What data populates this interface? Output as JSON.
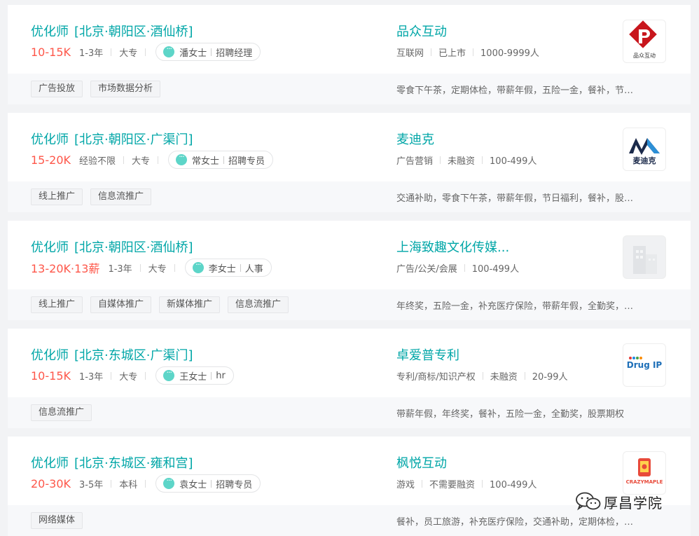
{
  "jobs": [
    {
      "title": "优化师",
      "location": "[北京·朝阳区·酒仙桥]",
      "salary": "10-15K",
      "experience": "1-3年",
      "degree": "大专",
      "recruiter_name": "潘女士",
      "recruiter_role": "招聘经理",
      "company": "品众互动",
      "industry": "互联网",
      "stage": "已上市",
      "size": "1000-9999人",
      "logo_text": "品众互动",
      "tags": [
        "广告投放",
        "市场数据分析"
      ],
      "welfare": "零食下午茶，定期体检，带薪年假，五险一金，餐补，节…"
    },
    {
      "title": "优化师",
      "location": "[北京·朝阳区·广渠门]",
      "salary": "15-20K",
      "experience": "经验不限",
      "degree": "大专",
      "recruiter_name": "常女士",
      "recruiter_role": "招聘专员",
      "company": "麦迪克",
      "industry": "广告营销",
      "stage": "未融资",
      "size": "100-499人",
      "logo_text": "麦迪克",
      "tags": [
        "线上推广",
        "信息流推广"
      ],
      "welfare": "交通补助，零食下午茶，带薪年假，节日福利，餐补，股…"
    },
    {
      "title": "优化师",
      "location": "[北京·朝阳区·酒仙桥]",
      "salary": "13-20K·13薪",
      "experience": "1-3年",
      "degree": "大专",
      "recruiter_name": "李女士",
      "recruiter_role": "人事",
      "company": "上海致趣文化传媒...",
      "industry": "广告/公关/会展",
      "stage": "",
      "size": "100-499人",
      "logo_text": "",
      "tags": [
        "线上推广",
        "自媒体推广",
        "新媒体推广",
        "信息流推广"
      ],
      "welfare": "年终奖，五险一金，补充医疗保险，带薪年假，全勤奖，…"
    },
    {
      "title": "优化师",
      "location": "[北京·东城区·广渠门]",
      "salary": "10-15K",
      "experience": "1-3年",
      "degree": "大专",
      "recruiter_name": "王女士",
      "recruiter_role": "hr",
      "company": "卓爱普专利",
      "industry": "专利/商标/知识产权",
      "stage": "未融资",
      "size": "20-99人",
      "logo_text": "Drug IP",
      "tags": [
        "信息流推广"
      ],
      "welfare": "带薪年假，年终奖，餐补，五险一金，全勤奖，股票期权"
    },
    {
      "title": "优化师",
      "location": "[北京·东城区·雍和宫]",
      "salary": "20-30K",
      "experience": "3-5年",
      "degree": "本科",
      "recruiter_name": "袁女士",
      "recruiter_role": "招聘专员",
      "company": "枫悦互动",
      "industry": "游戏",
      "stage": "不需要融资",
      "size": "100-499人",
      "logo_text": "CRAZYMAPLE",
      "tags": [
        "网络媒体"
      ],
      "welfare": "餐补，员工旅游，补充医疗保险，交通补助，定期体检，…"
    }
  ],
  "watermark": {
    "text": "厚昌学院"
  },
  "colors": {
    "accent": "#00a6a7",
    "salary": "#fe574a"
  }
}
